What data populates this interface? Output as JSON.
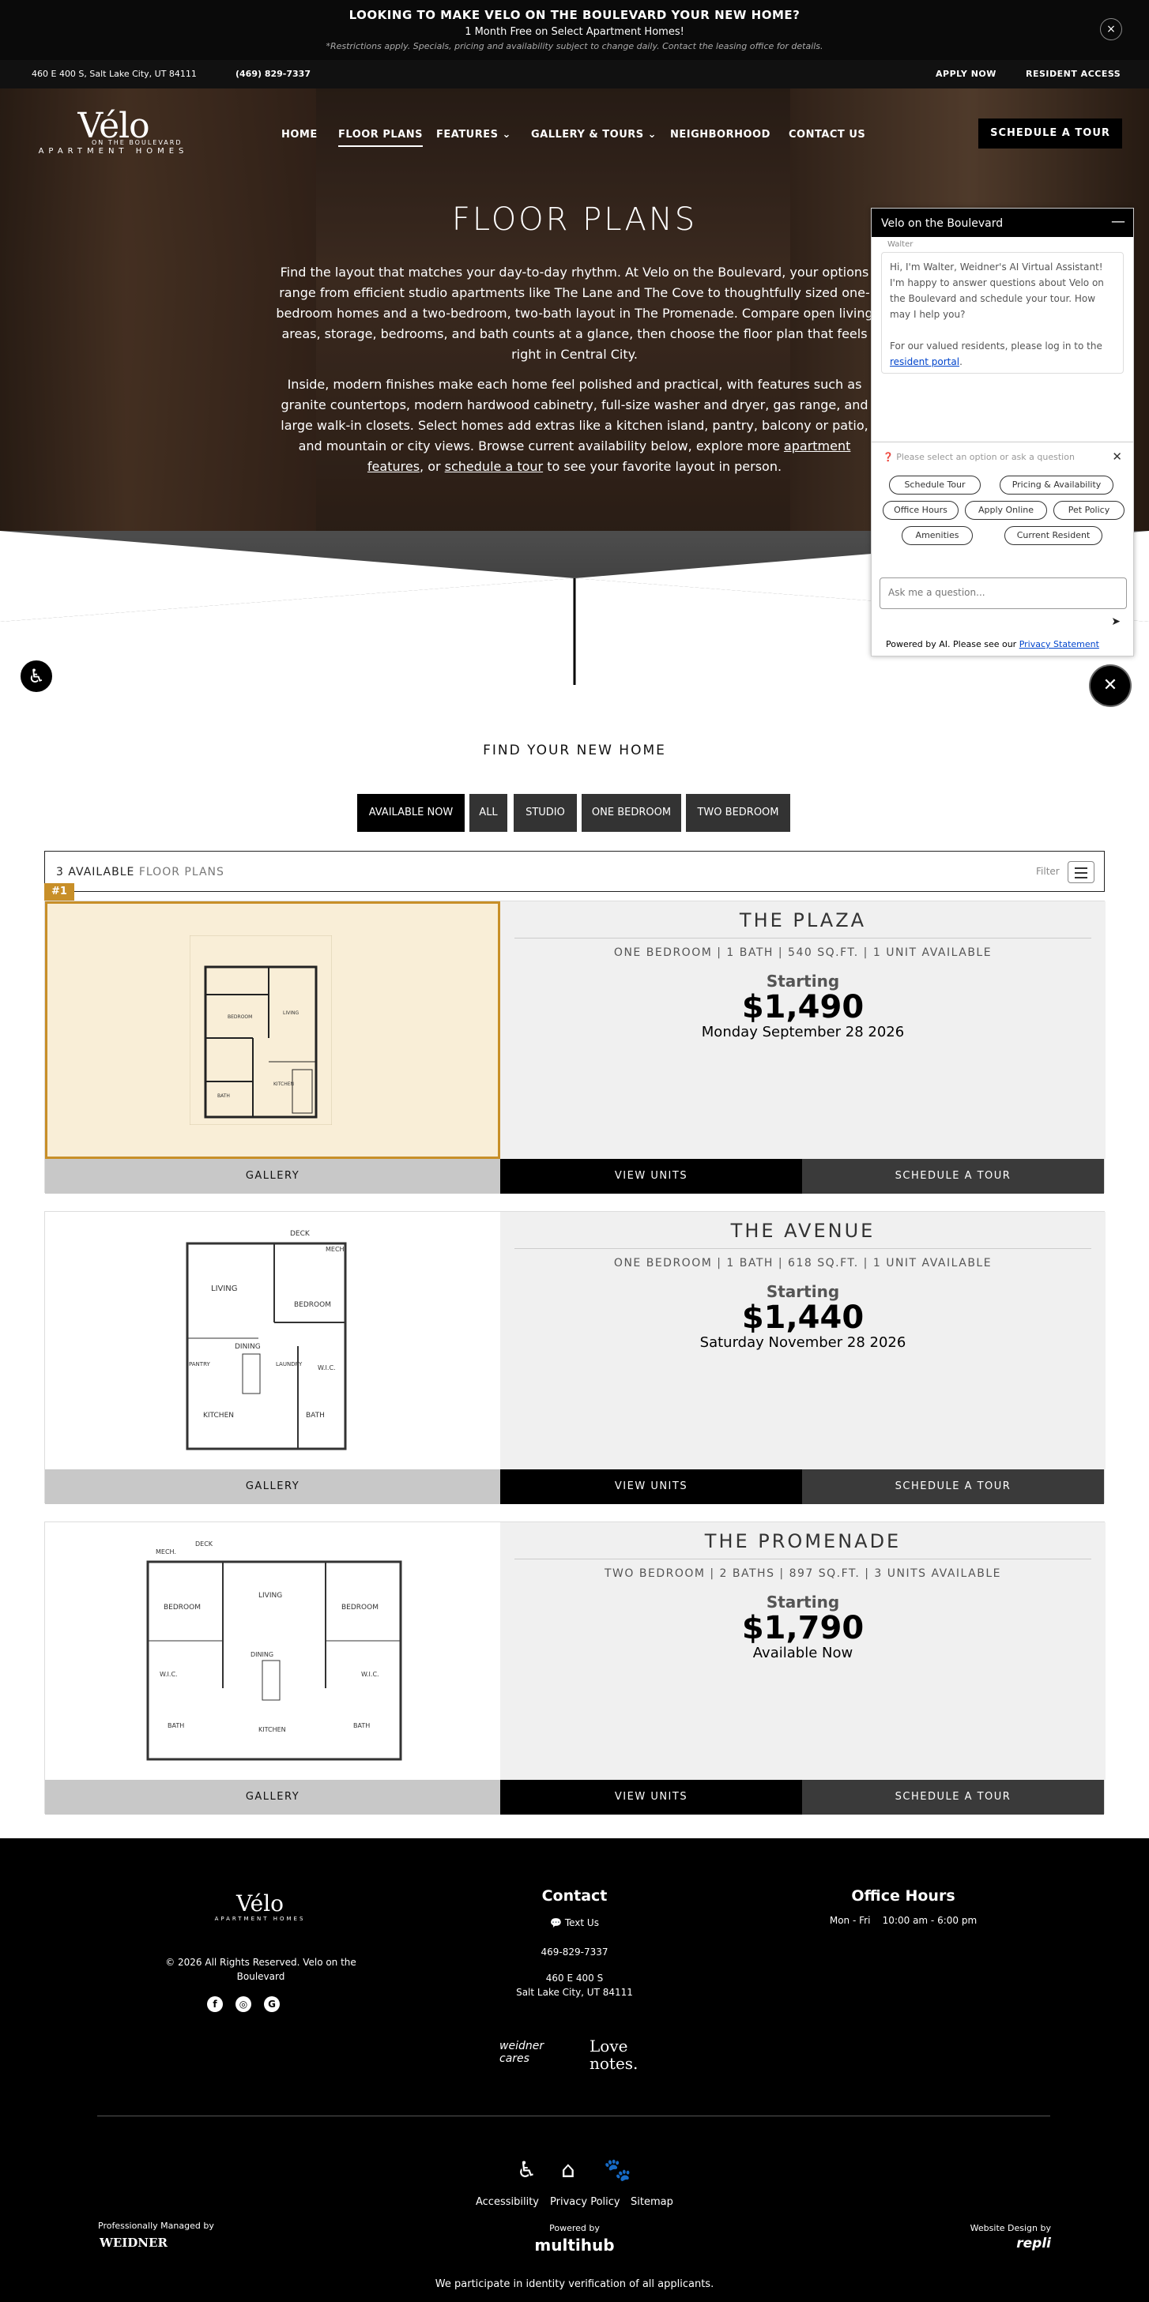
{
  "announcement": {
    "title": "LOOKING TO MAKE VELO ON THE BOULEVARD YOUR NEW HOME?",
    "subtitle": "1 Month Free on Select Apartment Homes!",
    "note": "*Restrictions apply. Specials, pricing and availability subject to change daily. Contact the leasing office for details.",
    "close_icon": "×"
  },
  "utility": {
    "address": "460 E 400 S, Salt Lake City, UT 84111",
    "phone": "(469) 829-7337",
    "apply": "APPLY NOW",
    "resident": "RESIDENT ACCESS"
  },
  "logo": {
    "main": "Vélo",
    "sub": "ON THE BOULEVARD",
    "tag": "APARTMENT HOMES"
  },
  "nav": {
    "home": "HOME",
    "floor_plans": "FLOOR PLANS",
    "features": "FEATURES ⌄",
    "gallery": "GALLERY & TOURS ⌄",
    "neighborhood": "NEIGHBORHOOD",
    "contact": "CONTACT US",
    "schedule": "SCHEDULE A TOUR"
  },
  "hero": {
    "title": "FLOOR PLANS",
    "p1": "Find the layout that matches your day-to-day rhythm. At Velo on the Boulevard, your options range from efficient studio apartments like The Lane and The Cove to thoughtfully sized one-bedroom homes and a two-bedroom, two-bath layout in The Promenade. Compare open living areas, storage, bedrooms, and bath counts at a glance, then choose the floor plan that feels right in Central City.",
    "p2_a": "Inside, modern finishes make each home feel polished and practical, with features such as granite countertops, modern hardwood cabinetry, full-size washer and dryer, gas range, and large walk-in closets. Select homes add extras like a kitchen island, pantry, balcony or patio, and mountain or city views. Browse current availability below, explore more ",
    "p2_link1": "apartment features",
    "p2_b": ", or ",
    "p2_link2": "schedule a tour",
    "p2_c": " to see your favorite layout in person."
  },
  "chat": {
    "header": "Velo on the Boulevard",
    "min_icon": "—",
    "agent": "Walter",
    "message": "Hi, I'm Walter, Weidner's AI Virtual Assistant! I'm happy to answer questions about Velo on the Boulevard and schedule your tour. How may I help you?",
    "message2": "For our valued residents, please log in to the ",
    "portal": "resident portal",
    "dot": ".",
    "select_prompt": "Please select an option or ask a question",
    "chips": [
      "Schedule Tour",
      "Pricing & Availability",
      "Office Hours",
      "Apply Online",
      "Pet Policy",
      "Amenities",
      "Current Resident"
    ],
    "placeholder": "Ask me a question...",
    "powered": "Powered by AI. Please see our ",
    "privacy": "Privacy Statement",
    "close_icon": "✕"
  },
  "find": {
    "heading": "FIND YOUR NEW HOME",
    "filters": [
      "AVAILABLE NOW",
      "ALL",
      "STUDIO",
      "ONE BEDROOM",
      "TWO BEDROOM"
    ],
    "count": "3 AVAILABLE",
    "count_label": "FLOOR PLANS",
    "filter_label": "Filter",
    "badge": "#1"
  },
  "plans": [
    {
      "name": "THE PLAZA",
      "details": "ONE BEDROOM | 1 BATH | 540 SQ.FT. | 1 UNIT AVAILABLE",
      "starting": "Starting",
      "price": "$1,490",
      "date": "Monday September 28 2026"
    },
    {
      "name": "THE AVENUE",
      "details": "ONE BEDROOM | 1 BATH | 618 SQ.FT. | 1 UNIT AVAILABLE",
      "starting": "Starting",
      "price": "$1,440",
      "date": "Saturday November 28 2026"
    },
    {
      "name": "THE PROMENADE",
      "details": "TWO BEDROOM | 2 BATHS | 897 SQ.FT. | 3 UNITS AVAILABLE",
      "starting": "Starting",
      "price": "$1,790",
      "date": "Available Now"
    }
  ],
  "card_buttons": {
    "gallery": "GALLERY",
    "units": "VIEW UNITS",
    "tour": "SCHEDULE A TOUR"
  },
  "floorplan_labels": {
    "deck": "DECK",
    "mech": "MECH.",
    "living": "LIVING",
    "bedroom": "BEDROOM",
    "dining": "DINING",
    "pantry": "PANTRY",
    "laundry": "LAUNDRY",
    "wic": "W.I.C.",
    "kitchen": "KITCHEN",
    "bath": "BATH"
  },
  "footer": {
    "copyright": "© 2026 All Rights Reserved. Velo on the Boulevard",
    "contact_h": "Contact",
    "text_us": "Text Us",
    "phone": "469-829-7337",
    "addr1": "460 E 400 S",
    "addr2": "Salt Lake City, UT 84111",
    "hours_h": "Office Hours",
    "hours": "Mon - Fri    10:00 am - 6:00 pm",
    "weidner_cares": "weidner cares",
    "love_notes": "Love notes.",
    "accessibility": "Accessibility",
    "privacy": "Privacy Policy",
    "sitemap": "Sitemap",
    "managed": "Professionally Managed by",
    "weidner": "WEIDNER",
    "powered": "Powered by",
    "multihub": "multihub",
    "design": "Website Design by",
    "repli": "repli",
    "verify": "We participate in identity verification of all applicants.",
    "social": [
      "f",
      "◎",
      "G"
    ]
  }
}
